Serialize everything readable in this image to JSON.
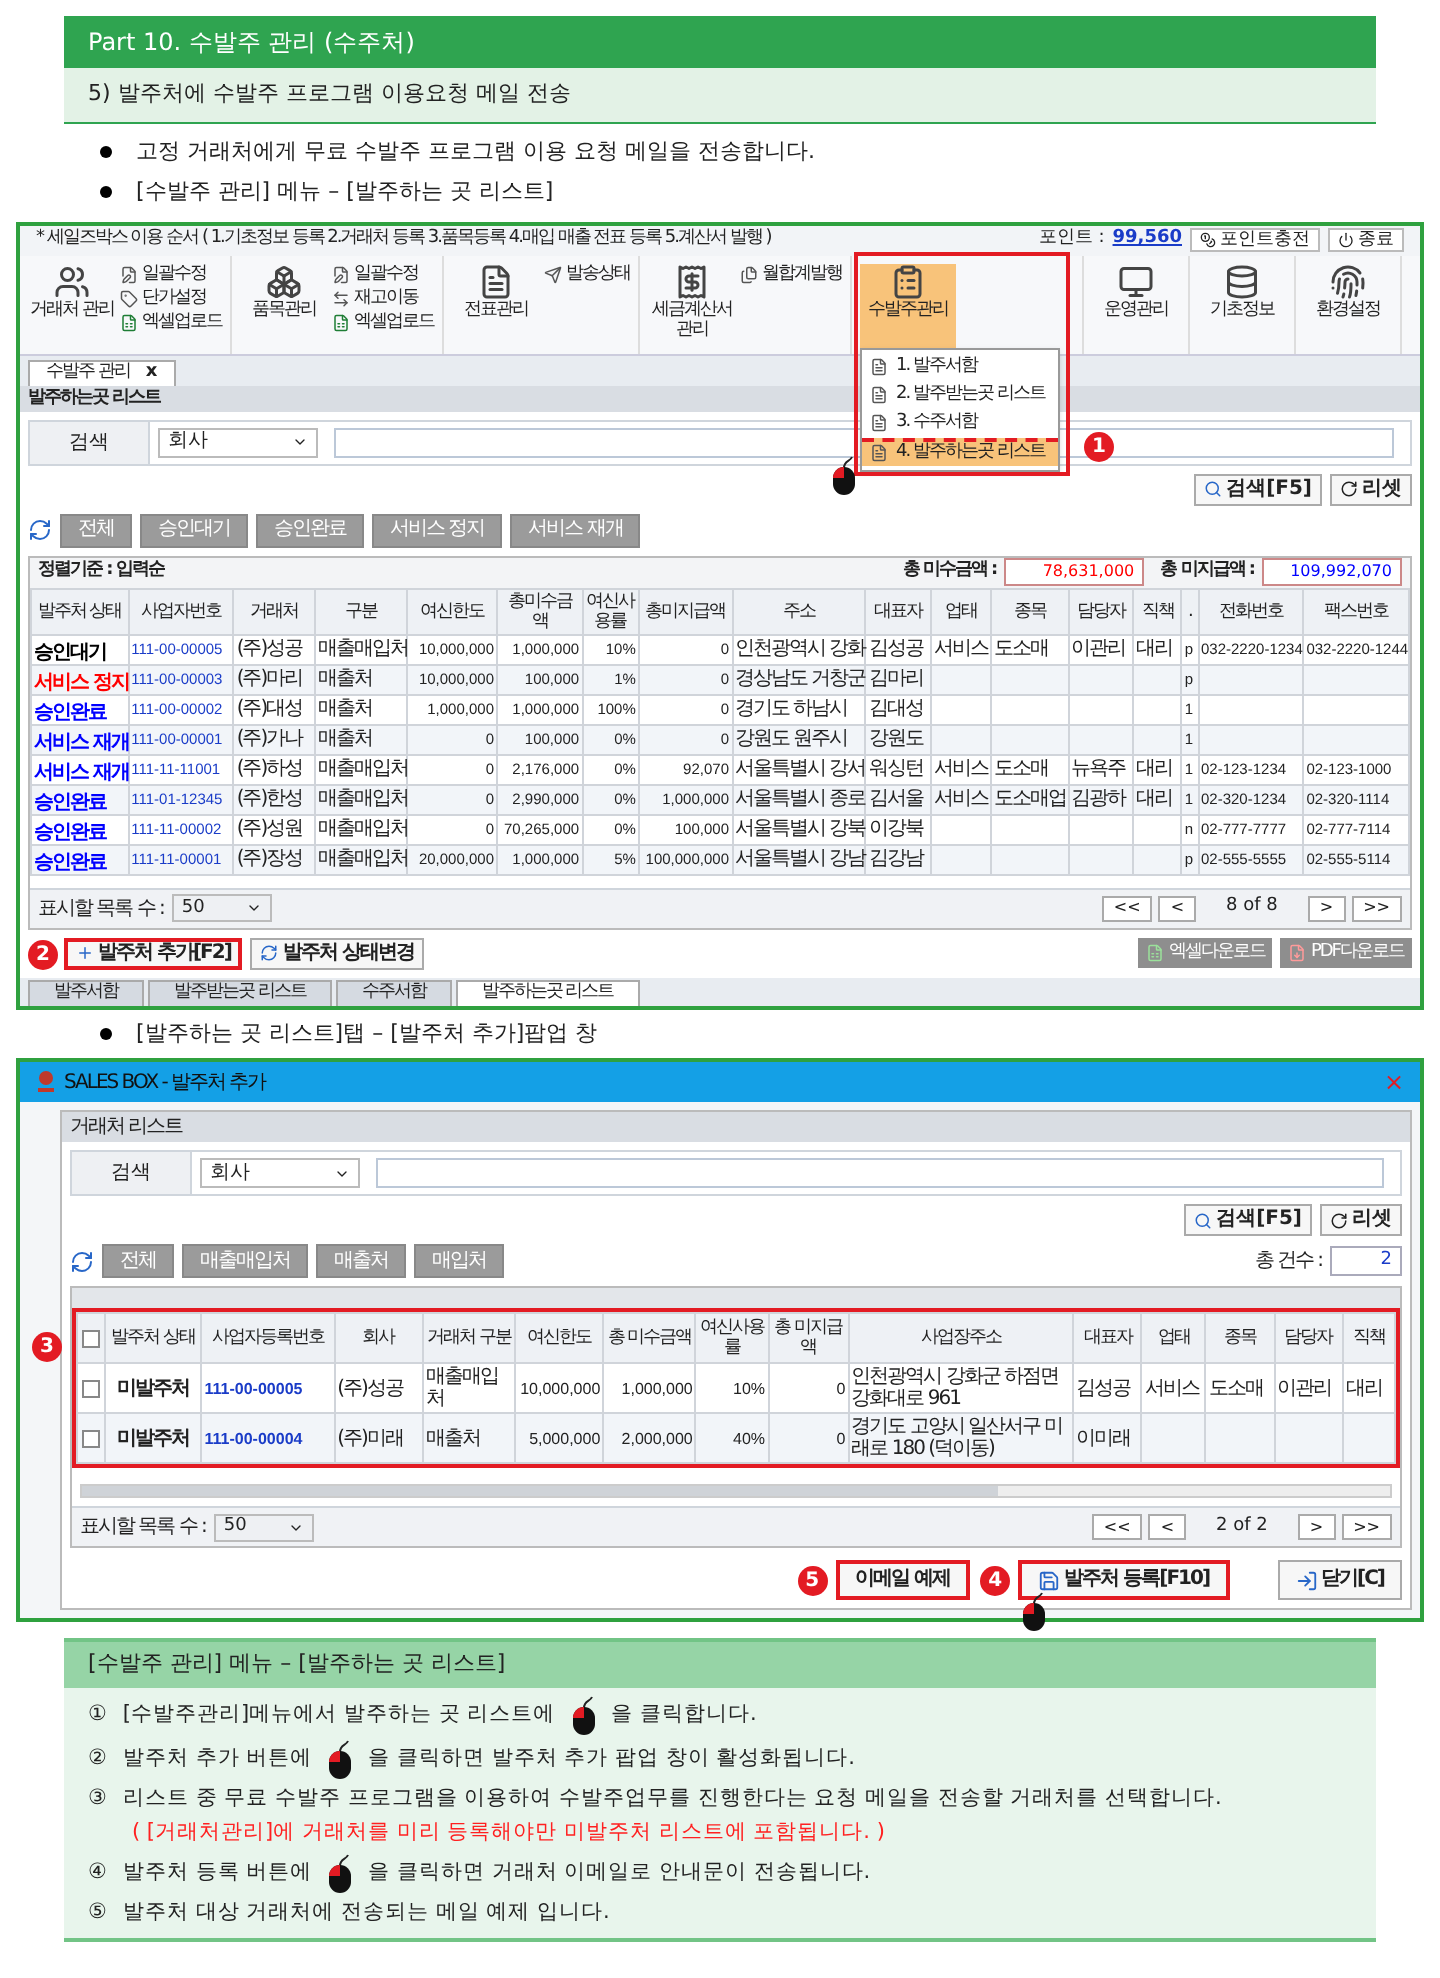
{
  "header": {
    "title": "Part 10. 수발주 관리 (수주처)"
  },
  "section_title": "5) 발주처에 수발주 프로그램 이용요청 메일 전송",
  "intro_bullets": [
    "고정 거래처에게 무료 수발주 프로그램 이용 요청 메일을 전송합니다.",
    "[수발주 관리] 메뉴 – [발주하는 곳 리스트]"
  ],
  "main_window": {
    "order_steps": "* 세일즈박스 이용 순서 ( 1.기초정보 등록  2.거래처 등록  3.품목등록  4.매입 매출 전표 등록  5.계산서 발행 )",
    "points_label": "포인트 :",
    "points_value": "99,560",
    "top_buttons": [
      "포인트충전",
      "종료"
    ],
    "ribbon": [
      {
        "label": "거래처 관리",
        "open": false,
        "small": [
          "일괄수정",
          "단가설정",
          "엑셀업로드"
        ]
      },
      {
        "label": "품목관리",
        "open": false,
        "small": [
          "일괄수정",
          "재고이동",
          "엑셀업로드"
        ]
      },
      {
        "label": "전표관리",
        "open": false,
        "small": [
          "발송상태"
        ]
      },
      {
        "label": "세금계산서 관리",
        "open": false,
        "small": [
          "월합계발행"
        ]
      },
      {
        "label": "수발주관리",
        "open": true
      },
      {
        "label": "운영관리",
        "open": false
      },
      {
        "label": "기초정보",
        "open": false
      },
      {
        "label": "환경설정",
        "open": false
      }
    ],
    "menu": {
      "badge": "1",
      "items": [
        {
          "label": "1. 발주서함",
          "selected": false
        },
        {
          "label": "2. 발주받는곳 리스트",
          "selected": false
        },
        {
          "label": "3. 수주서함",
          "selected": false
        },
        {
          "label": "4. 발주하는곳 리스트",
          "selected": true
        }
      ]
    },
    "doc_tab": {
      "label": "수발주 관리",
      "close": "x"
    },
    "panel_title": "발주하는곳 리스트",
    "search": {
      "label": "검색",
      "select": "회사"
    },
    "search_buttons": [
      "검색[F5]",
      "리셋"
    ],
    "filters": [
      "전체",
      "승인대기",
      "승인완료",
      "서비스 정지",
      "서비스 재개"
    ],
    "sort_label": "정렬기준 : 입력순",
    "totals": [
      {
        "label": "총 미수금액 :",
        "value": "78,631,000",
        "color": "#ff0000"
      },
      {
        "label": "총 미지급액 :",
        "value": "109,992,070",
        "color": "#0000ff"
      }
    ],
    "table": {
      "columns": [
        "발주처 상태",
        "사업자번호",
        "거래처",
        "구분",
        "여신한도",
        "총미수금액",
        "여신사용률",
        "총미지급액",
        "주소",
        "대표자",
        "업태",
        "종목",
        "담당자",
        "직책",
        ".",
        "전화번호",
        "팩스번호"
      ],
      "rows": [
        {
          "color": "#000000",
          "cells": [
            "승인대기",
            "111-00-00005",
            "(주)성공",
            "매출매입처",
            "10,000,000",
            "1,000,000",
            "10%",
            "0",
            "인천광역시 강화",
            "김성공",
            "서비스",
            "도소매",
            "이관리",
            "대리",
            "p",
            "032-2220-1234",
            "032-2220-1244"
          ]
        },
        {
          "color": "#ff0000",
          "cells": [
            "서비스 정지",
            "111-00-00003",
            "(주)마리",
            "매출처",
            "10,000,000",
            "100,000",
            "1%",
            "0",
            "경상남도 거창군",
            "김마리",
            null,
            null,
            null,
            null,
            "p",
            null,
            null
          ]
        },
        {
          "color": "#0000ff",
          "cells": [
            "승인완료",
            "111-00-00002",
            "(주)대성",
            "매출처",
            "1,000,000",
            "1,000,000",
            "100%",
            "0",
            "경기도 하남시",
            "김대성",
            null,
            null,
            null,
            null,
            "1",
            null,
            null
          ]
        },
        {
          "color": "#0000ff",
          "cells": [
            "서비스 재개",
            "111-00-00001",
            "(주)가나",
            "매출처",
            "0",
            "100,000",
            "0%",
            "0",
            "강원도 원주시",
            "강원도",
            null,
            null,
            null,
            null,
            "1",
            null,
            null
          ]
        },
        {
          "color": "#0000ff",
          "cells": [
            "서비스 재개",
            "111-11-11001",
            "(주)하성",
            "매출매입처",
            "0",
            "2,176,000",
            "0%",
            "92,070",
            "서울특별시 강서",
            "워싱턴",
            "서비스",
            "도소매",
            "뉴욕주",
            "대리",
            "1",
            "02-123-1234",
            "02-123-1000"
          ]
        },
        {
          "color": "#0000ff",
          "cells": [
            "승인완료",
            "111-01-12345",
            "(주)한성",
            "매출매입처",
            "0",
            "2,990,000",
            "0%",
            "1,000,000",
            "서울특별시 종로",
            "김서울",
            "서비스",
            "도소매업",
            "김광하",
            "대리",
            "1",
            "02-320-1234",
            "02-320-1114"
          ]
        },
        {
          "color": "#0000ff",
          "cells": [
            "승인완료",
            "111-11-00002",
            "(주)성원",
            "매출매입처",
            "0",
            "70,265,000",
            "0%",
            "100,000",
            "서울특별시 강북",
            "이강북",
            null,
            null,
            null,
            null,
            "n",
            "02-777-7777",
            "02-777-7114"
          ]
        },
        {
          "color": "#0000ff",
          "cells": [
            "승인완료",
            "111-11-00001",
            "(주)장성",
            "매출매입처",
            "20,000,000",
            "1,000,000",
            "5%",
            "100,000,000",
            "서울특별시 강남",
            "김강남",
            null,
            null,
            null,
            null,
            "p",
            "02-555-5555",
            "02-555-5114"
          ]
        }
      ]
    },
    "page_size_label": "표시할 목록 수 :",
    "page_size": "50",
    "pager": [
      "<<",
      "<",
      "8 of 8",
      ">",
      ">>"
    ],
    "actions": [
      "발주처 추가[F2]",
      "발주처 상태변경"
    ],
    "action_badge": "2",
    "downloads": [
      "엑셀다운로드",
      "PDF다운로드"
    ],
    "bottom_tabs": [
      {
        "label": "발주서함",
        "selected": false
      },
      {
        "label": "발주받는곳 리스트",
        "selected": false
      },
      {
        "label": "수주서함",
        "selected": false
      },
      {
        "label": "발주하는곳 리스트",
        "selected": true
      }
    ]
  },
  "popup_bullet": "[발주하는 곳 리스트]탭 – [발주처 추가]팝업 창",
  "popup": {
    "title": "SALES BOX - 발주처 추가",
    "close": "×",
    "panel_title": "거래처 리스트",
    "search": {
      "label": "검색",
      "select": "회사"
    },
    "search_buttons": [
      "검색[F5]",
      "리셋"
    ],
    "filters": [
      "전체",
      "매출매입처",
      "매출처",
      "매입처"
    ],
    "count_label": "총 건수 :",
    "count": "2",
    "table_badge": "3",
    "select_all_checked": false,
    "columns": [
      "발주처 상태",
      "사업자등록번호",
      "회사",
      "거래처 구분",
      "여신한도",
      "총 미수금액",
      "여신사용률",
      "총 미지급액",
      "사업장주소",
      "대표자",
      "업태",
      "종목",
      "담당자",
      "직책"
    ],
    "rows": [
      {
        "checked": false,
        "cells": [
          "미발주처",
          "111-00-00005",
          "(주)성공",
          "매출매입처",
          "10,000,000",
          "1,000,000",
          "10%",
          "0",
          "인천광역시 강화군 하점면 강화대로 961",
          "김성공",
          "서비스",
          "도소매",
          "이관리",
          "대리"
        ]
      },
      {
        "checked": false,
        "cells": [
          "미발주처",
          "111-00-00004",
          "(주)미래",
          "매출처",
          "5,000,000",
          "2,000,000",
          "40%",
          "0",
          "경기도 고양시 일산서구 미래로 180 (덕이동)",
          "이미래",
          null,
          null,
          null,
          null
        ]
      }
    ],
    "page_size_label": "표시할 목록 수 :",
    "page_size": "50",
    "pager": [
      "<<",
      "<",
      "2 of 2",
      ">",
      ">>"
    ],
    "buttons": [
      {
        "label": "이메일 예제",
        "badge": "5"
      },
      {
        "label": "발주처 등록[F10]",
        "badge": "4"
      },
      {
        "label": "닫기[C]"
      }
    ]
  },
  "instructions": {
    "title": "[수발주 관리] 메뉴 – [발주하는 곳 리스트]",
    "items": [
      {
        "kind": "click",
        "mark": "①",
        "before": "[수발주관리]메뉴에서 발주하는 곳 리스트에",
        "after": "을 클릭합니다."
      },
      {
        "kind": "click",
        "mark": "②",
        "before": "발주처 추가 버튼에",
        "after": "을 클릭하면 발주처 추가 팝업 창이 활성화됩니다."
      },
      {
        "kind": "text",
        "mark": "③",
        "before": "리스트 중 무료 수발주 프로그램을 이용하여 수발주업무를 진행한다는 요청 메일을 전송할 거래처를 선택합니다."
      },
      {
        "kind": "note",
        "before": "( [거래처관리]에 거래처를 미리 등록해야만 미발주처 리스트에 포함됩니다. )"
      },
      {
        "kind": "click",
        "mark": "④",
        "before": "발주처 등록  버튼에",
        "after": "을 클릭하면 거래처 이메일로 안내문이 전송됩니다."
      },
      {
        "kind": "text",
        "mark": "⑤",
        "before": "발주처 대상 거래처에 전송되는 메일 예제 입니다."
      }
    ]
  }
}
